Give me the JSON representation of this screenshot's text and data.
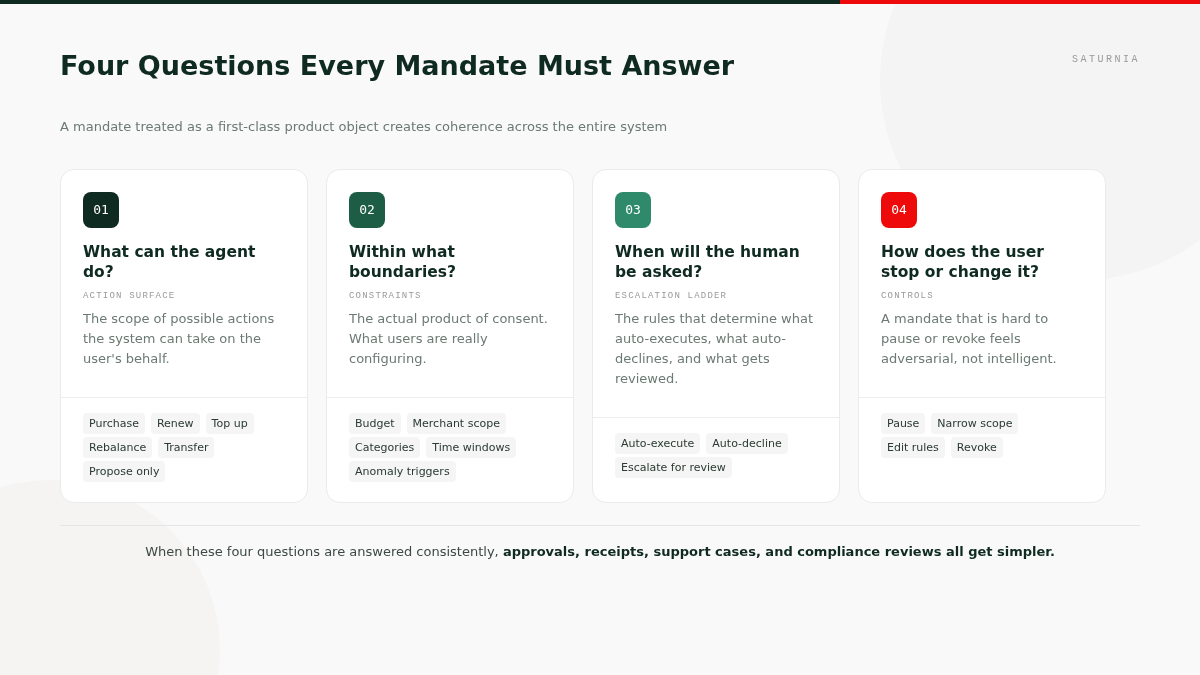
{
  "brand": "SATURNIA",
  "title": "Four Questions Every Mandate Must Answer",
  "subtitle": "A mandate treated as a first-class product object creates coherence across the entire system",
  "cards": [
    {
      "number": "01",
      "color": "#0f2a20",
      "title": "What can the agent do?",
      "label": "ACTION SURFACE",
      "description": "The scope of possible actions the system can take on the user's behalf.",
      "tags": [
        "Purchase",
        "Renew",
        "Top up",
        "Rebalance",
        "Transfer",
        "Propose only"
      ]
    },
    {
      "number": "02",
      "color": "#1d5c45",
      "title": "Within what boundaries?",
      "label": "CONSTRAINTS",
      "description": "The actual product of consent. What users are really configuring.",
      "tags": [
        "Budget",
        "Merchant scope",
        "Categories",
        "Time windows",
        "Anomaly triggers"
      ]
    },
    {
      "number": "03",
      "color": "#2e8a6a",
      "title": "When will the human be asked?",
      "label": "ESCALATION LADDER",
      "description": "The rules that determine what auto-executes, what auto-declines, and what gets reviewed.",
      "tags": [
        "Auto-execute",
        "Auto-decline",
        "Escalate for review"
      ]
    },
    {
      "number": "04",
      "color": "#ee0a0a",
      "title": "How does the user stop or change it?",
      "label": "CONTROLS",
      "description": "A mandate that is hard to pause or revoke feels adversarial, not intelligent.",
      "tags": [
        "Pause",
        "Narrow scope",
        "Edit rules",
        "Revoke"
      ]
    }
  ],
  "footer": "When these four questions are answered consistently, **approvals, receipts, support cases, and compliance reviews all get simpler.**"
}
